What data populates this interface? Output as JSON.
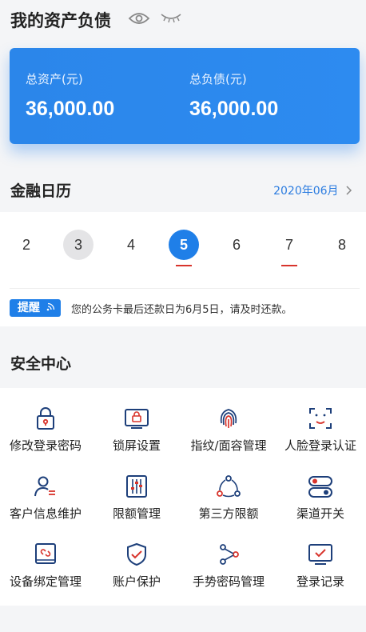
{
  "header": {
    "title": "我的资产负债"
  },
  "assets_card": {
    "total_assets_label": "总资产(元)",
    "total_assets_value": "36,000.00",
    "total_liabilities_label": "总负债(元)",
    "total_liabilities_value": "36,000.00"
  },
  "calendar": {
    "title": "金融日历",
    "month": "2020年06月",
    "days": [
      "2",
      "3",
      "4",
      "5",
      "6",
      "7",
      "8"
    ],
    "reminder_badge": "提醒",
    "reminder_text": "您的公务卡最后还款日为6月5日，请及时还款。"
  },
  "security": {
    "title": "安全中心",
    "items": [
      {
        "label": "修改登录密码",
        "icon": "lock-icon"
      },
      {
        "label": "锁屏设置",
        "icon": "screen-lock-icon"
      },
      {
        "label": "指纹/面容管理",
        "icon": "fingerprint-icon"
      },
      {
        "label": "人脸登录认证",
        "icon": "face-scan-icon"
      },
      {
        "label": "客户信息维护",
        "icon": "user-info-icon"
      },
      {
        "label": "限额管理",
        "icon": "sliders-icon"
      },
      {
        "label": "第三方限额",
        "icon": "network-icon"
      },
      {
        "label": "渠道开关",
        "icon": "toggle-icon"
      },
      {
        "label": "设备绑定管理",
        "icon": "device-link-icon"
      },
      {
        "label": "账户保护",
        "icon": "shield-check-icon"
      },
      {
        "label": "手势密码管理",
        "icon": "gesture-icon"
      },
      {
        "label": "登录记录",
        "icon": "monitor-check-icon"
      }
    ]
  },
  "colors": {
    "primary": "#1f7fe8",
    "accent_red": "#d8342c",
    "icon_navy": "#1d3f7a"
  }
}
